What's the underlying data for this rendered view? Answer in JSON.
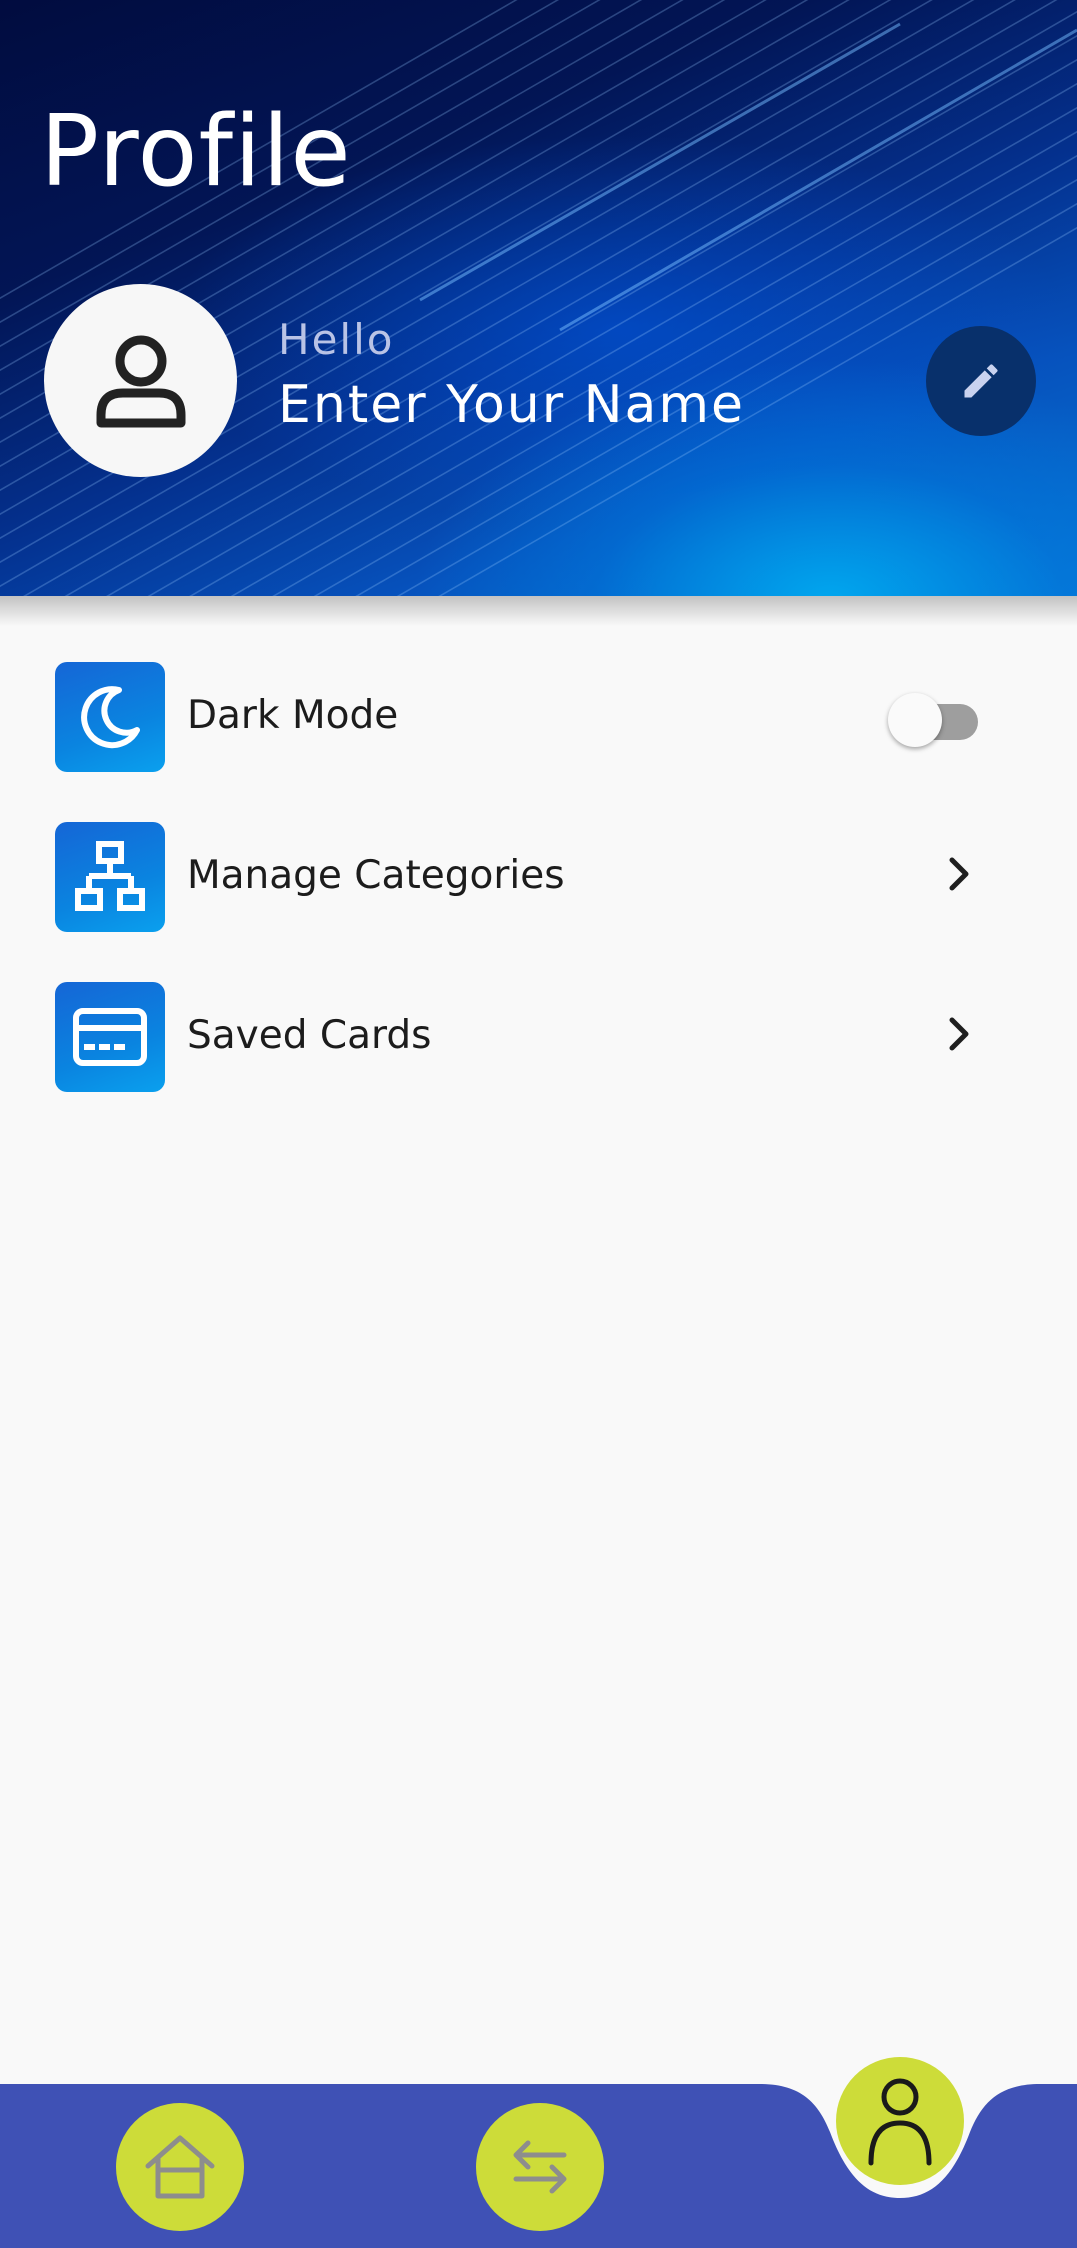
{
  "header": {
    "title": "Profile",
    "greeting": "Hello",
    "name": "Enter Your Name"
  },
  "settings": {
    "items": [
      {
        "label": "Dark Mode",
        "icon": "moon-icon",
        "control": "toggle",
        "toggle_on": false
      },
      {
        "label": "Manage Categories",
        "icon": "hierarchy-icon",
        "control": "chevron"
      },
      {
        "label": "Saved Cards",
        "icon": "credit-card-icon",
        "control": "chevron"
      }
    ]
  },
  "bottom_nav": {
    "items": [
      {
        "icon": "home-icon",
        "active": false
      },
      {
        "icon": "transfer-arrows-icon",
        "active": false
      },
      {
        "icon": "person-icon",
        "active": true
      }
    ]
  },
  "colors": {
    "header_dark": "#021555",
    "header_bright": "#0a9ae8",
    "icon_box": "#0a84e0",
    "nav_bar": "#3f51b5",
    "nav_button": "#cddc39",
    "background": "#f9f9f9"
  }
}
